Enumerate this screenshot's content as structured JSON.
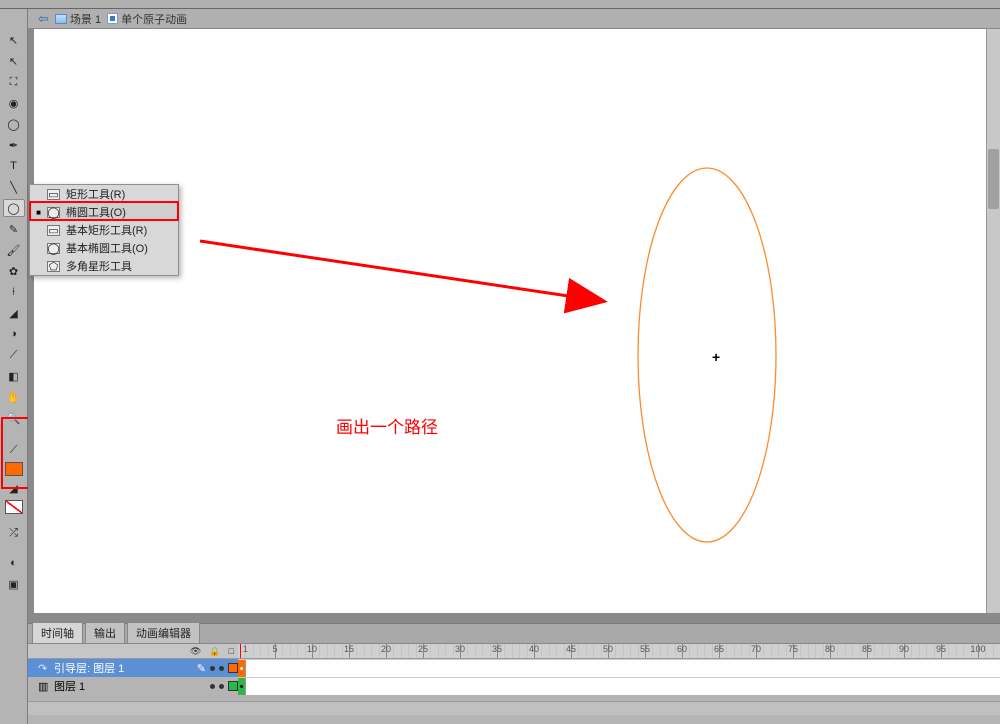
{
  "breadcrumb": {
    "back_glyph": "⇦",
    "scene": "场景 1",
    "clip": "单个原子动画"
  },
  "tools": {
    "items": [
      {
        "name": "selection",
        "glyph": "↖"
      },
      {
        "name": "subselect",
        "glyph": "↖"
      },
      {
        "name": "freetransform",
        "glyph": "⛶"
      },
      {
        "name": "3drotate",
        "glyph": "◉"
      },
      {
        "name": "lasso",
        "glyph": "◯"
      },
      {
        "name": "pen",
        "glyph": "✒"
      },
      {
        "name": "text",
        "glyph": "T"
      },
      {
        "name": "line",
        "glyph": "╲"
      },
      {
        "name": "shape",
        "glyph": "◯"
      },
      {
        "name": "pencil",
        "glyph": "✎"
      },
      {
        "name": "brush",
        "glyph": "🖌"
      },
      {
        "name": "deco",
        "glyph": "✿"
      },
      {
        "name": "bone",
        "glyph": "⟊"
      },
      {
        "name": "paintbucket",
        "glyph": "◢"
      },
      {
        "name": "inkbottle",
        "glyph": "◑"
      },
      {
        "name": "eyedropper",
        "glyph": "⟋"
      },
      {
        "name": "eraser",
        "glyph": "◧"
      },
      {
        "name": "hand",
        "glyph": "✋"
      },
      {
        "name": "zoom",
        "glyph": "🔍"
      }
    ],
    "flyout": [
      {
        "label": "矩形工具(R)",
        "sel": false,
        "ico": "▭"
      },
      {
        "label": "椭圆工具(O)",
        "sel": true,
        "ico": "◯"
      },
      {
        "label": "基本矩形工具(R)",
        "sel": false,
        "ico": "▭"
      },
      {
        "label": "基本椭圆工具(O)",
        "sel": false,
        "ico": "◯"
      },
      {
        "label": "多角星形工具",
        "sel": false,
        "ico": "⬠"
      }
    ]
  },
  "annotation": {
    "text": "画出一个路径",
    "crosshair": "+"
  },
  "timeline": {
    "tabs": {
      "a": "时间轴",
      "b": "输出",
      "c": "动画编辑器"
    },
    "header_icons": {
      "eye": "👁",
      "lock": "🔒",
      "outline": "□"
    },
    "ruler_marks": [
      1,
      5,
      10,
      15,
      20,
      25,
      30,
      35,
      40,
      45,
      50,
      55,
      60,
      65,
      70,
      75,
      80,
      85,
      90,
      95,
      100
    ],
    "layers": [
      {
        "name": "引导层: 图层 1",
        "type": "guide",
        "sel": true,
        "color": "orange"
      },
      {
        "name": "图层 1",
        "type": "normal",
        "sel": false,
        "color": "green"
      }
    ]
  }
}
